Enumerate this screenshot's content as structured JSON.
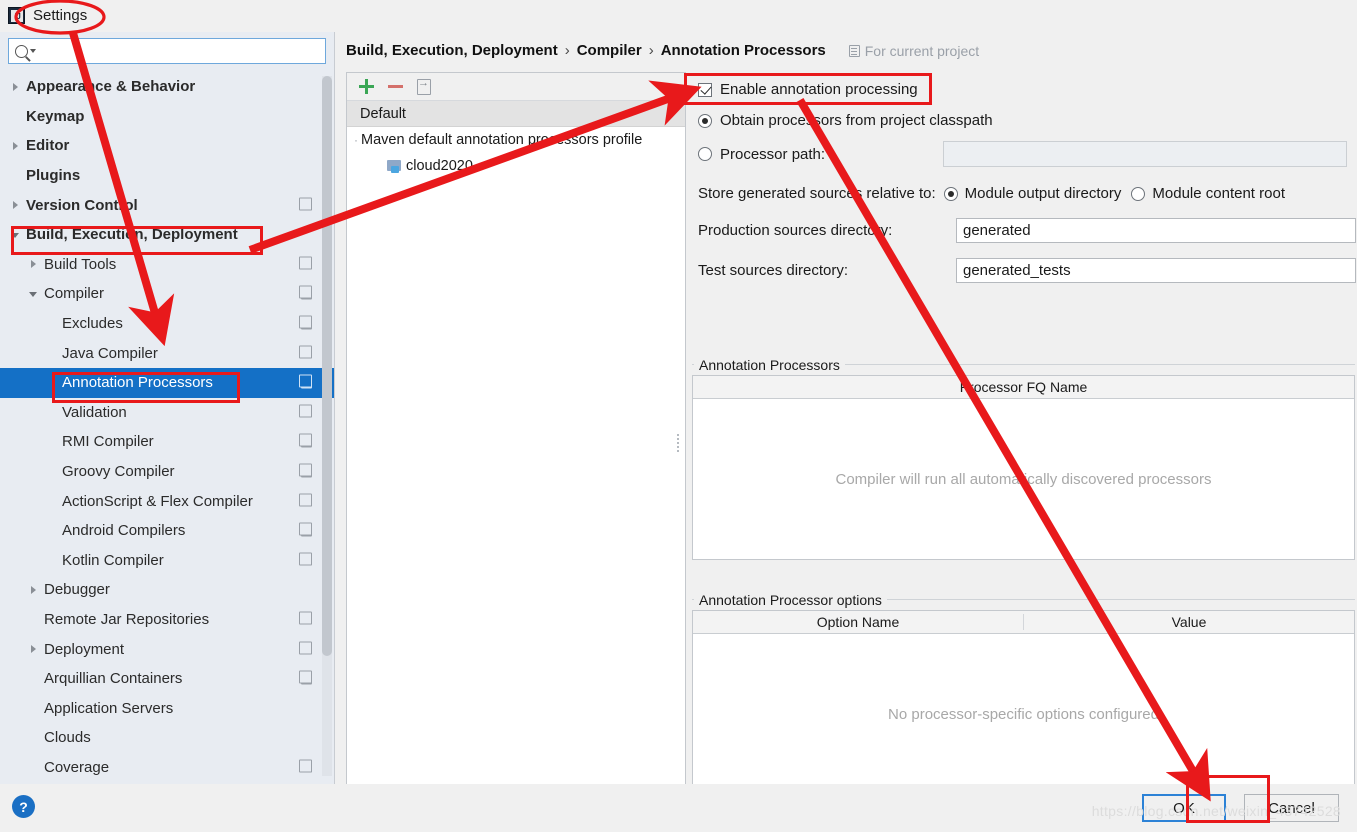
{
  "window": {
    "title": "Settings",
    "app_icon": "intellij-idea-icon"
  },
  "search": {
    "value": "",
    "placeholder": "",
    "icon": "search-icon"
  },
  "sidebar": {
    "items": [
      {
        "label": "Appearance & Behavior",
        "indent": 0,
        "expander": "collapsed",
        "bold": true,
        "copy": false,
        "selected": false
      },
      {
        "label": "Keymap",
        "indent": 0,
        "expander": "none",
        "bold": true,
        "copy": false,
        "selected": false
      },
      {
        "label": "Editor",
        "indent": 0,
        "expander": "collapsed",
        "bold": true,
        "copy": false,
        "selected": false
      },
      {
        "label": "Plugins",
        "indent": 0,
        "expander": "none",
        "bold": true,
        "copy": false,
        "selected": false
      },
      {
        "label": "Version Control",
        "indent": 0,
        "expander": "collapsed",
        "bold": true,
        "copy": true,
        "selected": false
      },
      {
        "label": "Build, Execution, Deployment",
        "indent": 0,
        "expander": "expanded",
        "bold": true,
        "copy": false,
        "selected": false
      },
      {
        "label": "Build Tools",
        "indent": 1,
        "expander": "collapsed",
        "bold": false,
        "copy": true,
        "selected": false
      },
      {
        "label": "Compiler",
        "indent": 1,
        "expander": "expanded",
        "bold": false,
        "copy": true,
        "selected": false
      },
      {
        "label": "Excludes",
        "indent": 2,
        "expander": "none",
        "bold": false,
        "copy": true,
        "selected": false
      },
      {
        "label": "Java Compiler",
        "indent": 2,
        "expander": "none",
        "bold": false,
        "copy": true,
        "selected": false
      },
      {
        "label": "Annotation Processors",
        "indent": 2,
        "expander": "none",
        "bold": false,
        "copy": true,
        "selected": true
      },
      {
        "label": "Validation",
        "indent": 2,
        "expander": "none",
        "bold": false,
        "copy": true,
        "selected": false
      },
      {
        "label": "RMI Compiler",
        "indent": 2,
        "expander": "none",
        "bold": false,
        "copy": true,
        "selected": false
      },
      {
        "label": "Groovy Compiler",
        "indent": 2,
        "expander": "none",
        "bold": false,
        "copy": true,
        "selected": false
      },
      {
        "label": "ActionScript & Flex Compiler",
        "indent": 2,
        "expander": "none",
        "bold": false,
        "copy": true,
        "selected": false
      },
      {
        "label": "Android Compilers",
        "indent": 2,
        "expander": "none",
        "bold": false,
        "copy": true,
        "selected": false
      },
      {
        "label": "Kotlin Compiler",
        "indent": 2,
        "expander": "none",
        "bold": false,
        "copy": true,
        "selected": false
      },
      {
        "label": "Debugger",
        "indent": 1,
        "expander": "collapsed",
        "bold": false,
        "copy": false,
        "selected": false
      },
      {
        "label": "Remote Jar Repositories",
        "indent": 1,
        "expander": "none",
        "bold": false,
        "copy": true,
        "selected": false
      },
      {
        "label": "Deployment",
        "indent": 1,
        "expander": "collapsed",
        "bold": false,
        "copy": true,
        "selected": false
      },
      {
        "label": "Arquillian Containers",
        "indent": 1,
        "expander": "none",
        "bold": false,
        "copy": true,
        "selected": false
      },
      {
        "label": "Application Servers",
        "indent": 1,
        "expander": "none",
        "bold": false,
        "copy": false,
        "selected": false
      },
      {
        "label": "Clouds",
        "indent": 1,
        "expander": "none",
        "bold": false,
        "copy": false,
        "selected": false
      },
      {
        "label": "Coverage",
        "indent": 1,
        "expander": "none",
        "bold": false,
        "copy": true,
        "selected": false
      }
    ]
  },
  "breadcrumb": {
    "part1": "Build, Execution, Deployment",
    "sep1": "›",
    "part2": "Compiler",
    "sep2": "›",
    "part3": "Annotation Processors",
    "scope_label": "For current project",
    "scope_icon": "project-scope-icon"
  },
  "profiles": {
    "toolbar": {
      "add_icon": "plus-icon",
      "remove_icon": "minus-icon",
      "move_icon": "move-to-profile-icon"
    },
    "header": "Default",
    "rows": [
      {
        "label": "Maven default annotation processors profile",
        "type": "profile"
      },
      {
        "label": "cloud2020",
        "type": "module",
        "icon": "module-icon"
      }
    ]
  },
  "settings": {
    "enable_annotation_processing": {
      "label": "Enable annotation processing",
      "checked": true
    },
    "processor_source": {
      "options": [
        {
          "label": "Obtain processors from project classpath",
          "selected": true
        },
        {
          "label": "Processor path:",
          "selected": false
        }
      ],
      "processor_path_value": "",
      "processor_path_disabled": true
    },
    "store_relative": {
      "label": "Store generated sources relative to:",
      "options": [
        {
          "label": "Module output directory",
          "selected": true
        },
        {
          "label": "Module content root",
          "selected": false
        }
      ]
    },
    "production_sources": {
      "label": "Production sources directory:",
      "value": "generated"
    },
    "test_sources": {
      "label": "Test sources directory:",
      "value": "generated_tests"
    },
    "processors_table": {
      "group_title": "Annotation Processors",
      "columns": [
        "Processor FQ Name"
      ],
      "rows": [],
      "empty_text": "Compiler will run all automatically discovered processors"
    },
    "options_table": {
      "group_title": "Annotation Processor options",
      "columns": [
        "Option Name",
        "Value"
      ],
      "rows": [],
      "empty_text": "No processor-specific options configured"
    }
  },
  "footer": {
    "help_label": "?",
    "ok_label": "OK",
    "cancel_label": "Cancel",
    "watermark": "https://blog.csdn.net/weixin_43742528"
  },
  "colors": {
    "selection_blue": "#1470c6",
    "annotation_red": "#e8191b",
    "focus_blue": "#2c82d6",
    "add_green": "#3aa655",
    "remove_red": "#d4706b",
    "help_blue": "#1a6fc4"
  }
}
